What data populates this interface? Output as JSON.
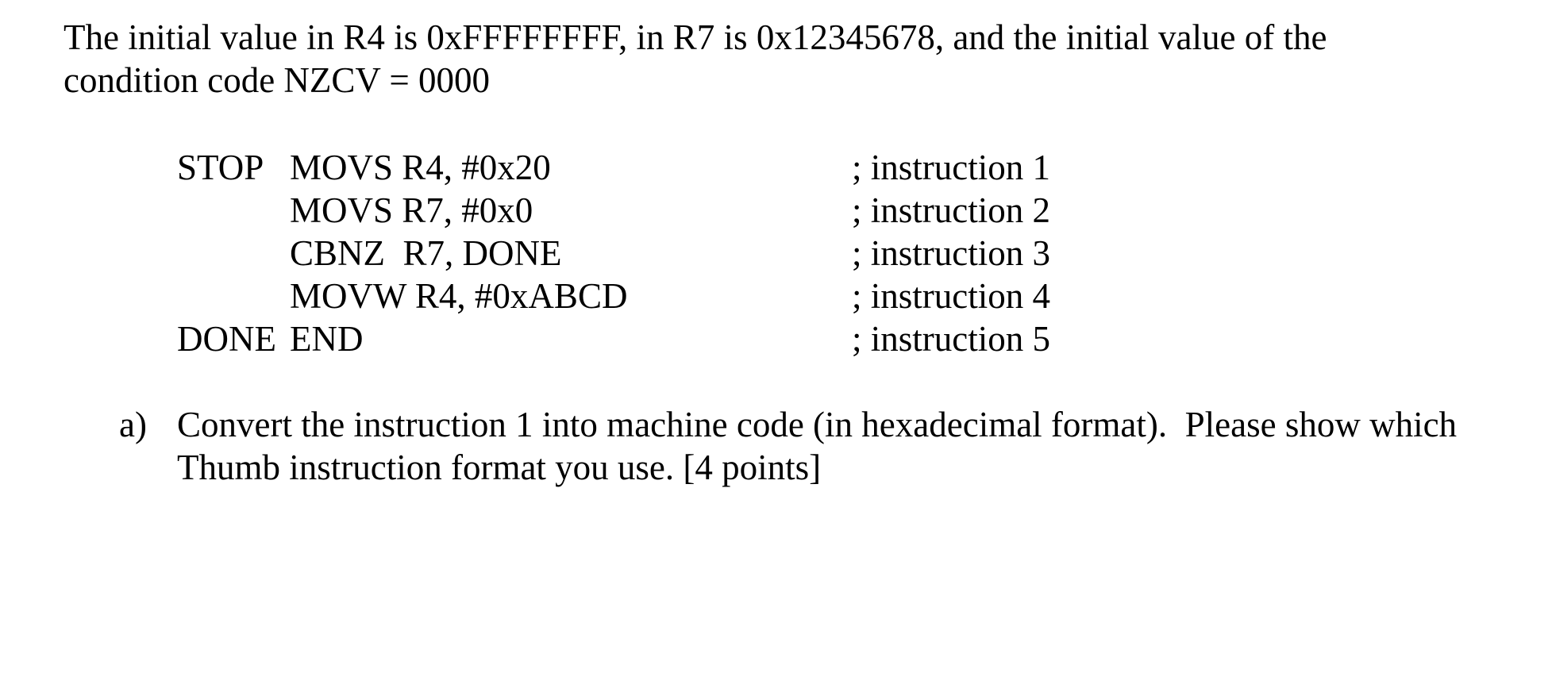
{
  "intro": {
    "line1": "The initial value in R4 is 0xFFFFFFFF, in R7 is 0x12345678, and the initial value of the",
    "line2": "condition code NZCV = 0000"
  },
  "code": [
    {
      "label": "STOP",
      "instruction": "MOVS R4, #0x20",
      "comment": "; instruction 1"
    },
    {
      "label": "",
      "instruction": "MOVS R7, #0x0",
      "comment": "; instruction 2"
    },
    {
      "label": "",
      "instruction": "CBNZ  R7, DONE",
      "comment": "; instruction 3"
    },
    {
      "label": "",
      "instruction": "MOVW R4, #0xABCD",
      "comment": "; instruction 4"
    },
    {
      "label": "DONE",
      "instruction": "END",
      "comment": "; instruction 5"
    }
  ],
  "question": {
    "marker": "a)",
    "line1": "Convert the instruction 1 into machine code (in hexadecimal format).  Please show which",
    "line2": "Thumb instruction format you use. [4 points]"
  }
}
